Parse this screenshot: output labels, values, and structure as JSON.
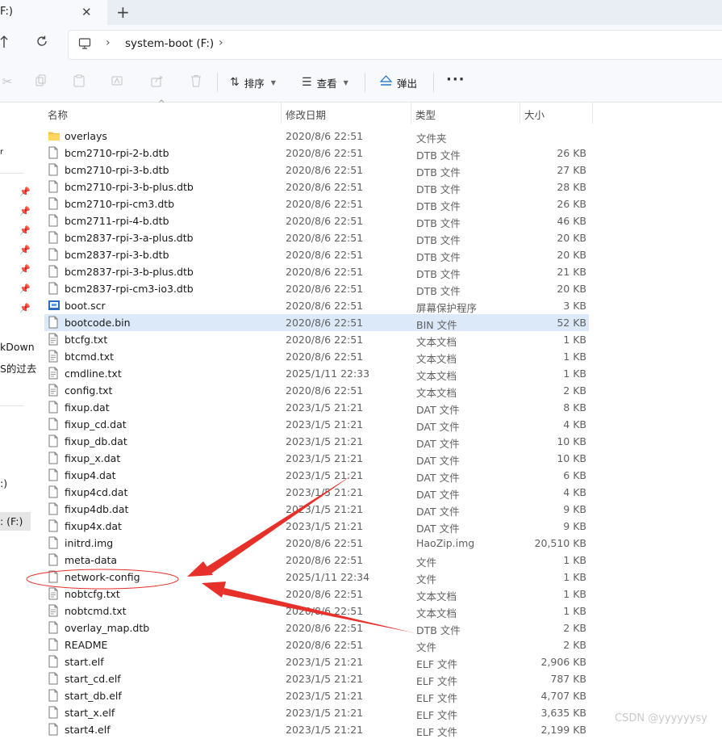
{
  "tab": {
    "title": "F:)",
    "close": "✕",
    "new": "+"
  },
  "address": {
    "drive": "system-boot (F:)",
    "sep": "›"
  },
  "toolbar": {
    "sort_label": "排序",
    "view_label": "查看",
    "eject_label": "弹出",
    "more_label": "···"
  },
  "sidebar": {
    "frag_r": "r",
    "frag_markdown": "kDown",
    "frag_s": "S的过去",
    "frag_drive_c": ":)",
    "frag_drive_f": ": (F:)"
  },
  "columns": {
    "name": "名称",
    "date": "修改日期",
    "type": "类型",
    "size": "大小"
  },
  "files": [
    {
      "name": "overlays",
      "date": "2020/8/6 22:51",
      "type": "文件夹",
      "size": "",
      "icon": "folder-icon"
    },
    {
      "name": "bcm2710-rpi-2-b.dtb",
      "date": "2020/8/6 22:51",
      "type": "DTB 文件",
      "size": "26 KB",
      "icon": "file-icon"
    },
    {
      "name": "bcm2710-rpi-3-b.dtb",
      "date": "2020/8/6 22:51",
      "type": "DTB 文件",
      "size": "27 KB",
      "icon": "file-icon"
    },
    {
      "name": "bcm2710-rpi-3-b-plus.dtb",
      "date": "2020/8/6 22:51",
      "type": "DTB 文件",
      "size": "28 KB",
      "icon": "file-icon"
    },
    {
      "name": "bcm2710-rpi-cm3.dtb",
      "date": "2020/8/6 22:51",
      "type": "DTB 文件",
      "size": "26 KB",
      "icon": "file-icon"
    },
    {
      "name": "bcm2711-rpi-4-b.dtb",
      "date": "2020/8/6 22:51",
      "type": "DTB 文件",
      "size": "46 KB",
      "icon": "file-icon"
    },
    {
      "name": "bcm2837-rpi-3-a-plus.dtb",
      "date": "2020/8/6 22:51",
      "type": "DTB 文件",
      "size": "20 KB",
      "icon": "file-icon"
    },
    {
      "name": "bcm2837-rpi-3-b.dtb",
      "date": "2020/8/6 22:51",
      "type": "DTB 文件",
      "size": "20 KB",
      "icon": "file-icon"
    },
    {
      "name": "bcm2837-rpi-3-b-plus.dtb",
      "date": "2020/8/6 22:51",
      "type": "DTB 文件",
      "size": "21 KB",
      "icon": "file-icon"
    },
    {
      "name": "bcm2837-rpi-cm3-io3.dtb",
      "date": "2020/8/6 22:51",
      "type": "DTB 文件",
      "size": "20 KB",
      "icon": "file-icon"
    },
    {
      "name": "boot.scr",
      "date": "2020/8/6 22:51",
      "type": "屏幕保护程序",
      "size": "3 KB",
      "icon": "screensaver-icon"
    },
    {
      "name": "bootcode.bin",
      "date": "2020/8/6 22:51",
      "type": "BIN 文件",
      "size": "52 KB",
      "icon": "file-icon",
      "selected": true
    },
    {
      "name": "btcfg.txt",
      "date": "2020/8/6 22:51",
      "type": "文本文档",
      "size": "1 KB",
      "icon": "text-file-icon"
    },
    {
      "name": "btcmd.txt",
      "date": "2020/8/6 22:51",
      "type": "文本文档",
      "size": "1 KB",
      "icon": "text-file-icon"
    },
    {
      "name": "cmdline.txt",
      "date": "2025/1/11 22:33",
      "type": "文本文档",
      "size": "1 KB",
      "icon": "text-file-icon"
    },
    {
      "name": "config.txt",
      "date": "2020/8/6 22:51",
      "type": "文本文档",
      "size": "2 KB",
      "icon": "text-file-icon"
    },
    {
      "name": "fixup.dat",
      "date": "2023/1/5 21:21",
      "type": "DAT 文件",
      "size": "8 KB",
      "icon": "file-icon"
    },
    {
      "name": "fixup_cd.dat",
      "date": "2023/1/5 21:21",
      "type": "DAT 文件",
      "size": "4 KB",
      "icon": "file-icon"
    },
    {
      "name": "fixup_db.dat",
      "date": "2023/1/5 21:21",
      "type": "DAT 文件",
      "size": "10 KB",
      "icon": "file-icon"
    },
    {
      "name": "fixup_x.dat",
      "date": "2023/1/5 21:21",
      "type": "DAT 文件",
      "size": "10 KB",
      "icon": "file-icon"
    },
    {
      "name": "fixup4.dat",
      "date": "2023/1/5 21:21",
      "type": "DAT 文件",
      "size": "6 KB",
      "icon": "file-icon"
    },
    {
      "name": "fixup4cd.dat",
      "date": "2023/1/5 21:21",
      "type": "DAT 文件",
      "size": "4 KB",
      "icon": "file-icon"
    },
    {
      "name": "fixup4db.dat",
      "date": "2023/1/5 21:21",
      "type": "DAT 文件",
      "size": "9 KB",
      "icon": "file-icon"
    },
    {
      "name": "fixup4x.dat",
      "date": "2023/1/5 21:21",
      "type": "DAT 文件",
      "size": "9 KB",
      "icon": "file-icon"
    },
    {
      "name": "initrd.img",
      "date": "2020/8/6 22:51",
      "type": "HaoZip.img",
      "size": "20,510 KB",
      "icon": "file-icon"
    },
    {
      "name": "meta-data",
      "date": "2020/8/6 22:51",
      "type": "文件",
      "size": "1 KB",
      "icon": "file-icon"
    },
    {
      "name": "network-config",
      "date": "2025/1/11 22:34",
      "type": "文件",
      "size": "1 KB",
      "icon": "file-icon"
    },
    {
      "name": "nobtcfg.txt",
      "date": "2020/8/6 22:51",
      "type": "文本文档",
      "size": "1 KB",
      "icon": "text-file-icon"
    },
    {
      "name": "nobtcmd.txt",
      "date": "2020/8/6 22:51",
      "type": "文本文档",
      "size": "1 KB",
      "icon": "text-file-icon"
    },
    {
      "name": "overlay_map.dtb",
      "date": "2020/8/6 22:51",
      "type": "DTB 文件",
      "size": "2 KB",
      "icon": "file-icon"
    },
    {
      "name": "README",
      "date": "2020/8/6 22:51",
      "type": "文件",
      "size": "2 KB",
      "icon": "file-icon"
    },
    {
      "name": "start.elf",
      "date": "2023/1/5 21:21",
      "type": "ELF 文件",
      "size": "2,906 KB",
      "icon": "file-icon"
    },
    {
      "name": "start_cd.elf",
      "date": "2023/1/5 21:21",
      "type": "ELF 文件",
      "size": "787 KB",
      "icon": "file-icon"
    },
    {
      "name": "start_db.elf",
      "date": "2023/1/5 21:21",
      "type": "ELF 文件",
      "size": "4,707 KB",
      "icon": "file-icon"
    },
    {
      "name": "start_x.elf",
      "date": "2023/1/5 21:21",
      "type": "ELF 文件",
      "size": "3,635 KB",
      "icon": "file-icon"
    },
    {
      "name": "start4.elf",
      "date": "2023/1/5 21:21",
      "type": "ELF 文件",
      "size": "2,199 KB",
      "icon": "file-icon"
    }
  ],
  "annotation_color": "#e8302a",
  "selected_row_color": "#dbe9f8",
  "watermark": "CSDN @yyyyyysy"
}
